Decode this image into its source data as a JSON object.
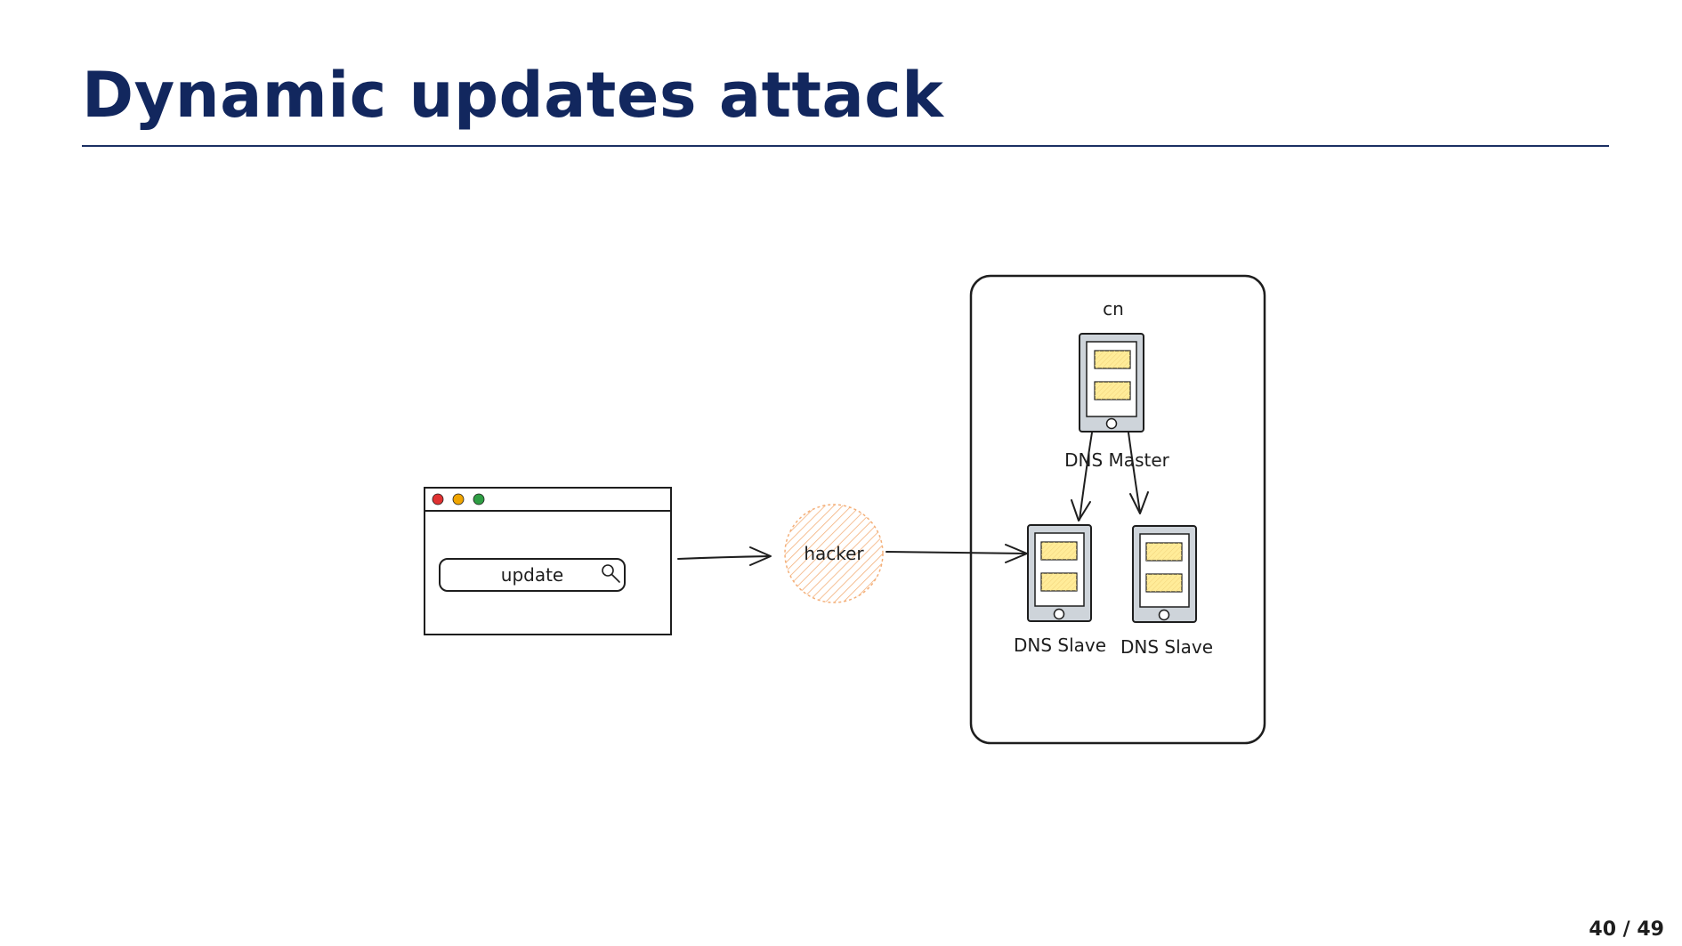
{
  "slide": {
    "title": "Dynamic updates attack",
    "page_number": "40 / 49"
  },
  "colors": {
    "title": "#12275e",
    "rule": "#1b2f63",
    "ink": "#1e1e1e",
    "hacker_fill": "#f7c79a",
    "server_body": "#ced4da",
    "server_slot": "#ffec99",
    "dot_red": "#e03131",
    "dot_yellow": "#f0a500",
    "dot_green": "#2f9e44"
  },
  "diagram": {
    "browser": {
      "search_text": "update",
      "icons": [
        "close-dot",
        "minimize-dot",
        "maximize-dot",
        "magnifier-icon"
      ]
    },
    "hacker": {
      "label": "hacker"
    },
    "zone": {
      "label": "cn"
    },
    "master": {
      "label": "DNS Master"
    },
    "slaves": [
      {
        "label": "DNS Slave"
      },
      {
        "label": "DNS Slave"
      }
    ]
  }
}
